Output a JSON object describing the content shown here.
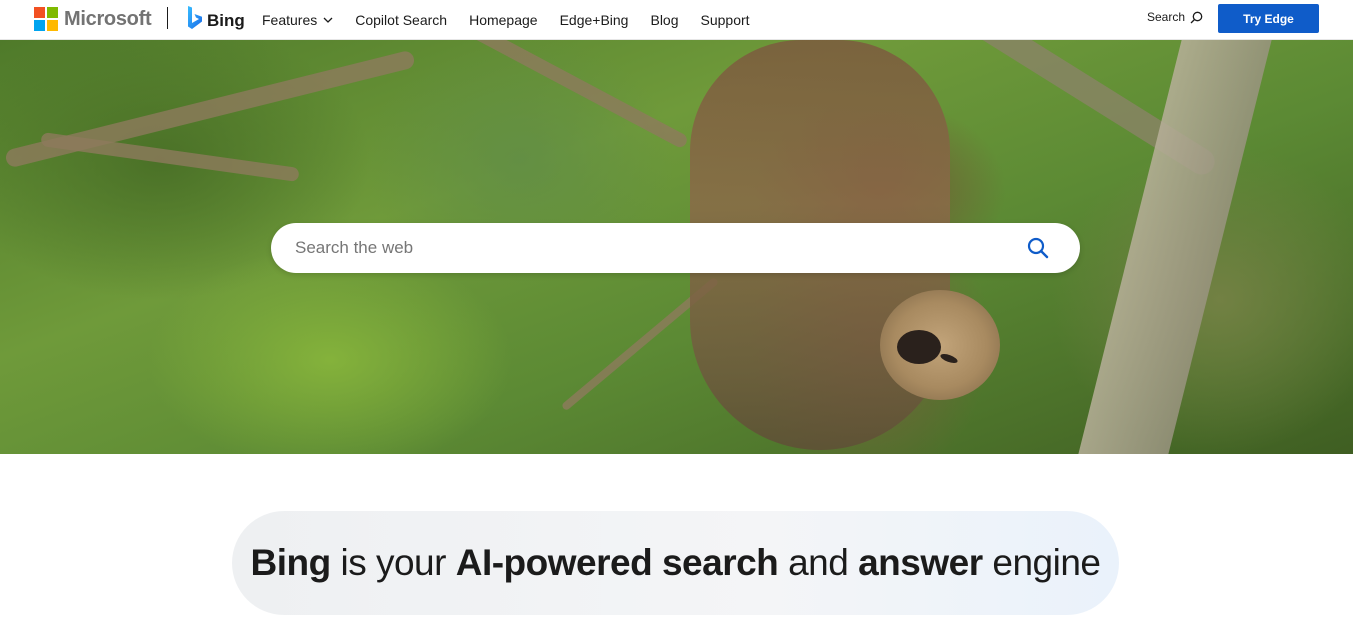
{
  "header": {
    "brand": "Microsoft",
    "product": "Bing",
    "nav": [
      {
        "label": "Features",
        "has_dropdown": true
      },
      {
        "label": "Copilot Search"
      },
      {
        "label": "Homepage"
      },
      {
        "label": "Edge+Bing"
      },
      {
        "label": "Blog"
      },
      {
        "label": "Support"
      }
    ],
    "search_label": "Search",
    "cta_label": "Try Edge",
    "cta_color": "#0f5cc9"
  },
  "hero": {
    "search_placeholder": "Search the web",
    "search_icon": "search-icon",
    "accent": "#0f5cc9"
  },
  "tagline": {
    "part1": "Bing",
    "part2": " is your ",
    "part3": "AI-powered search",
    "part4": " and ",
    "part5": "answer",
    "part6": " engine"
  },
  "colors": {
    "ms_red": "#f25022",
    "ms_green": "#7fba00",
    "ms_blue": "#00a4ef",
    "ms_yellow": "#ffb900"
  }
}
